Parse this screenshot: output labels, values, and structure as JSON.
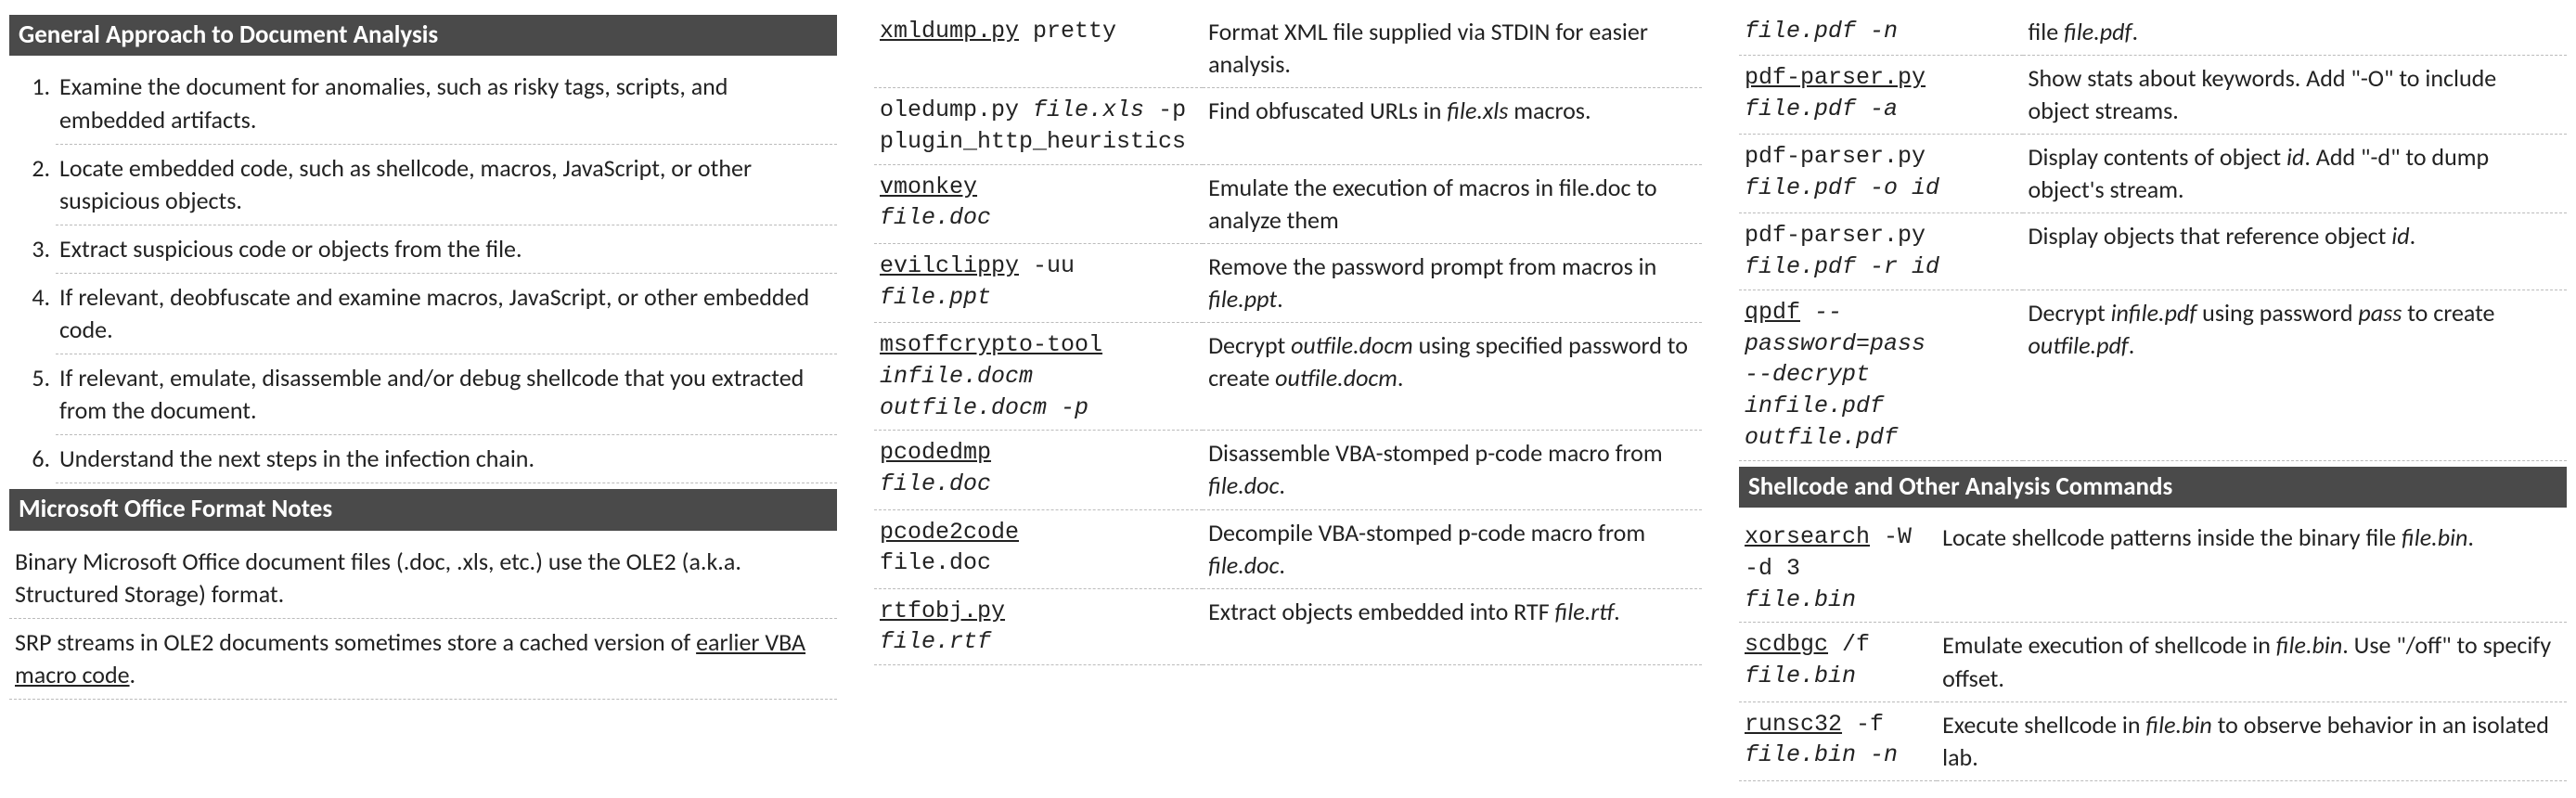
{
  "col1": {
    "hdr1": "General Approach to Document Analysis",
    "steps": [
      "Examine the document for anomalies, such as risky tags, scripts, and embedded artifacts.",
      "Locate embedded code, such as shellcode, macros, JavaScript, or other suspicious objects.",
      "Extract suspicious code or objects from the file.",
      "If relevant, deobfuscate and examine macros, JavaScript, or other embedded code.",
      "If relevant, emulate, disassemble and/or debug shellcode that you extracted from the document.",
      "Understand the next steps in the infection chain."
    ],
    "hdr2": "Microsoft Office Format Notes",
    "note1": "Binary Microsoft Office document files (.doc, .xls, etc.) use the OLE2 (a.k.a. Structured Storage) format.",
    "note2_a": "SRP streams in OLE2 documents sometimes store a cached version of ",
    "note2_link": "earlier VBA macro code",
    "note2_b": "."
  },
  "col2": {
    "rows": [
      {
        "tool": "xmldump.py",
        "rest": " pretty",
        "desc_a": "Format XML file supplied via STDIN for easier analysis."
      },
      {
        "plain_cmd_a": "oledump.py ",
        "arg1": "file.xls",
        "plain_cmd_b": " -p\nplugin_http_heuristics",
        "desc_a": "Find obfuscated URLs in ",
        "desc_ital": "file.xls",
        "desc_b": " macros."
      },
      {
        "tool": "vmonkey",
        "nl": true,
        "arg1": "file.doc",
        "desc_a": "Emulate the execution of macros in file.doc to analyze them"
      },
      {
        "tool": "evilclippy",
        "rest": " -uu",
        "nl": true,
        "arg1": "file.ppt",
        "desc_a": "Remove the password prompt from macros in ",
        "desc_ital": "file.ppt",
        "desc_b": "."
      },
      {
        "tool": "msoffcrypto-tool",
        "nl": true,
        "arg_line": "infile.docm\noutfile.docm -p",
        "desc_a": "Decrypt ",
        "desc_ital": "outfile.docm",
        "desc_b": " using specified password to create ",
        "desc_ital2": "outfile.docm",
        "desc_c": "."
      },
      {
        "tool": "pcodedmp",
        "nl": true,
        "arg1": "file.doc",
        "desc_a": "Disassemble VBA-stomped p-code macro from ",
        "desc_ital": "file.doc",
        "desc_b": "."
      },
      {
        "tool": "pcode2code",
        "nl": true,
        "plain_after": "file.doc",
        "desc_a": "Decompile VBA-stomped p-code macro from ",
        "desc_ital": "file.doc",
        "desc_b": "."
      },
      {
        "tool": "rtfobj.py",
        "nl": true,
        "arg1": "file.rtf",
        "desc_a": "Extract objects embedded into RTF ",
        "desc_ital": "file.rtf",
        "desc_b": "."
      }
    ]
  },
  "col3": {
    "rows_a": [
      {
        "arg_line": "file.pdf -n",
        "desc_a": "file ",
        "desc_ital": "file.pdf",
        "desc_b": "."
      },
      {
        "tool": "pdf-parser.py",
        "nl": true,
        "arg_line": "file.pdf -a",
        "desc_a": "Show stats about keywords. Add \"-O\" to include object streams."
      },
      {
        "plain_cmd_a": "pdf-parser.py\n",
        "arg_line": "file.pdf -o id",
        "desc_a": "Display contents of object ",
        "desc_ital": "id",
        "desc_b": ". Add \"-d\" to dump object's stream."
      },
      {
        "plain_cmd_a": "pdf-parser.py\n",
        "arg_line": "file.pdf -r id",
        "desc_a": "Display objects that reference object ",
        "desc_ital": "id",
        "desc_b": "."
      },
      {
        "tool": "qpdf",
        "rest_ital": " --password=pass\n--decrypt infile.pdf\noutfile.pdf",
        "desc_a": "Decrypt ",
        "desc_ital": "infile.pdf",
        "desc_b": " using password ",
        "desc_ital2": "pass",
        "desc_c": " to create ",
        "desc_ital3": "outfile.pdf",
        "desc_d": "."
      }
    ],
    "hdr": "Shellcode and Other Analysis Commands",
    "rows_b": [
      {
        "tool": "xorsearch",
        "rest": " -W\n-d 3 ",
        "arg1": "file.bin",
        "desc_a": "Locate shellcode patterns inside the binary file ",
        "desc_ital": "file.bin",
        "desc_b": "."
      },
      {
        "tool": "scdbgc",
        "rest": " /f",
        "nl": true,
        "arg1": "file.bin",
        "desc_a": "Emulate execution of shellcode in ",
        "desc_ital": "file.bin",
        "desc_b": ". Use \"/off\" to specify offset."
      },
      {
        "tool": "runsc32",
        "rest": " -f",
        "nl": true,
        "arg_line": "file.bin -n",
        "desc_a": "Execute shellcode in ",
        "desc_ital": "file.bin",
        "desc_b": " to observe behavior in an isolated lab."
      }
    ]
  }
}
